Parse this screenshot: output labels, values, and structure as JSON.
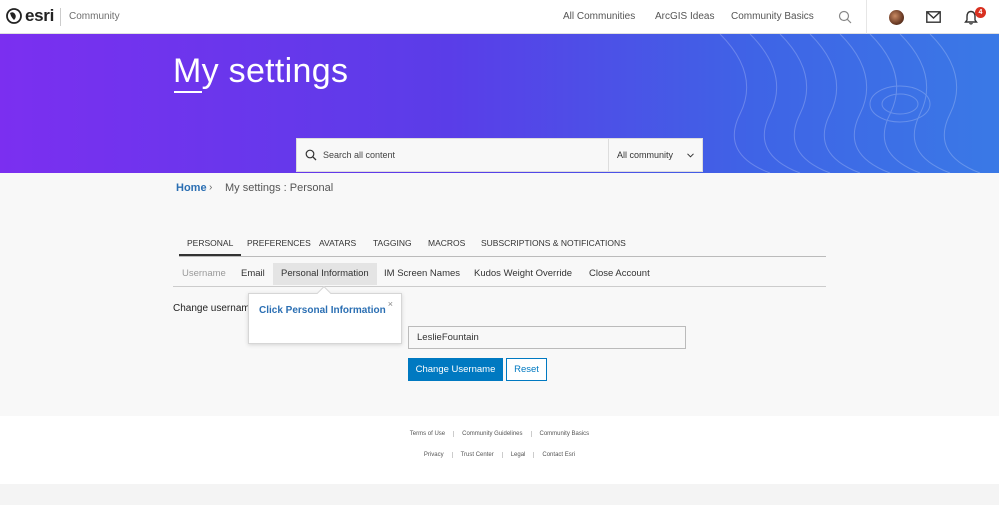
{
  "header": {
    "brand": "esri",
    "section": "Community",
    "nav": [
      "All Communities",
      "ArcGIS Ideas",
      "Community Basics"
    ],
    "notification_count": "4"
  },
  "hero": {
    "title": "My settings",
    "search_placeholder": "Search all content",
    "scope": "All community"
  },
  "breadcrumb": {
    "home": "Home",
    "separator": "›",
    "current": "My settings : Personal"
  },
  "tabs": [
    "PERSONAL",
    "PREFERENCES",
    "AVATARS",
    "TAGGING",
    "MACROS",
    "SUBSCRIPTIONS & NOTIFICATIONS"
  ],
  "subtabs": [
    "Username",
    "Email",
    "Personal Information",
    "IM Screen Names",
    "Kudos Weight Override",
    "Close Account"
  ],
  "form": {
    "label": "Change username",
    "username_value": "LeslieFountain",
    "primary_button": "Change Username",
    "secondary_button": "Reset"
  },
  "tooltip": {
    "text": "Click Personal Information",
    "close": "×"
  },
  "footer": {
    "row1": [
      "Terms of Use",
      "Community Guidelines",
      "Community Basics"
    ],
    "row2": [
      "Privacy",
      "Trust Center",
      "Legal",
      "Contact Esri"
    ]
  }
}
